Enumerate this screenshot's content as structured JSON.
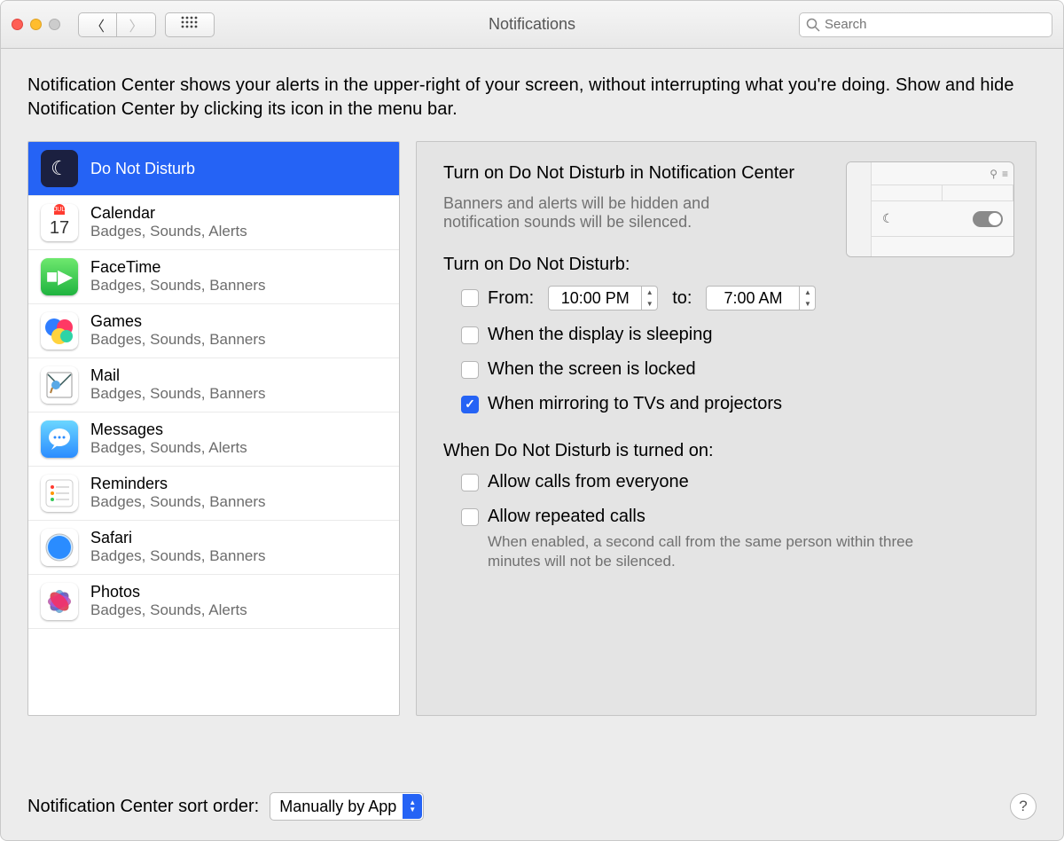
{
  "window_title": "Notifications",
  "search_placeholder": "Search",
  "intro": "Notification Center shows your alerts in the upper-right of your screen, without interrupting what you're doing. Show and hide Notification Center by clicking its icon in the menu bar.",
  "apps": [
    {
      "name": "Do Not Disturb",
      "sub": "",
      "icon": "dnd",
      "selected": true
    },
    {
      "name": "Calendar",
      "sub": "Badges, Sounds, Alerts",
      "icon": "calendar",
      "selected": false
    },
    {
      "name": "FaceTime",
      "sub": "Badges, Sounds, Banners",
      "icon": "facetime",
      "selected": false
    },
    {
      "name": "Games",
      "sub": "Badges, Sounds, Banners",
      "icon": "games",
      "selected": false
    },
    {
      "name": "Mail",
      "sub": "Badges, Sounds, Banners",
      "icon": "mail",
      "selected": false
    },
    {
      "name": "Messages",
      "sub": "Badges, Sounds, Alerts",
      "icon": "messages",
      "selected": false
    },
    {
      "name": "Reminders",
      "sub": "Badges, Sounds, Banners",
      "icon": "reminders",
      "selected": false
    },
    {
      "name": "Safari",
      "sub": "Badges, Sounds, Banners",
      "icon": "safari",
      "selected": false
    },
    {
      "name": "Photos",
      "sub": "Badges, Sounds, Alerts",
      "icon": "photos",
      "selected": false
    }
  ],
  "calendar_day": "17",
  "calendar_month": "JUL",
  "detail": {
    "heading": "Turn on Do Not Disturb in Notification Center",
    "desc": "Banners and alerts will be hidden and notification sounds will be silenced.",
    "section1": "Turn on Do Not Disturb:",
    "from_label": "From:",
    "from_value": "10:00 PM",
    "to_label": "to:",
    "to_value": "7:00 AM",
    "cb_from_checked": false,
    "cb_sleep_label": "When the display is sleeping",
    "cb_sleep_checked": false,
    "cb_locked_label": "When the screen is locked",
    "cb_locked_checked": false,
    "cb_mirror_label": "When mirroring to TVs and projectors",
    "cb_mirror_checked": true,
    "section2": "When Do Not Disturb is turned on:",
    "cb_allow_everyone_label": "Allow calls from everyone",
    "cb_allow_everyone_checked": false,
    "cb_repeated_label": "Allow repeated calls",
    "cb_repeated_checked": false,
    "repeated_help": "When enabled, a second call from the same person within three minutes will not be silenced."
  },
  "sort_label": "Notification Center sort order:",
  "sort_value": "Manually by App"
}
